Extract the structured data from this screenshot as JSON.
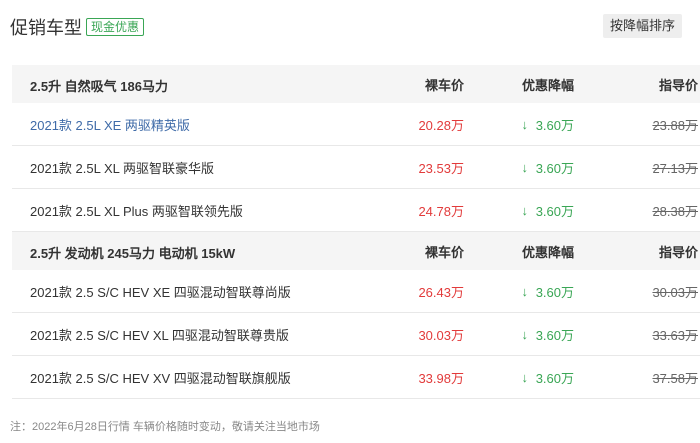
{
  "header": {
    "title": "促销车型",
    "badge": "现金优惠",
    "sort_button": "按降幅排序"
  },
  "colors": {
    "price": "#e23b3b",
    "discount": "#3aa655",
    "link": "#3f6ba8"
  },
  "groups": [
    {
      "title": "2.5升 自然吸气 186马力",
      "col_price": "裸车价",
      "col_discount": "优惠降幅",
      "col_guide": "指导价",
      "rows": [
        {
          "model": "2021款 2.5L XE 两驱精英版",
          "price": "20.28万",
          "discount": "3.60万",
          "guide": "23.88万"
        },
        {
          "model": "2021款 2.5L XL 两驱智联豪华版",
          "price": "23.53万",
          "discount": "3.60万",
          "guide": "27.13万"
        },
        {
          "model": "2021款 2.5L XL Plus 两驱智联领先版",
          "price": "24.78万",
          "discount": "3.60万",
          "guide": "28.38万"
        }
      ]
    },
    {
      "title": "2.5升 发动机 245马力 电动机 15kW",
      "col_price": "裸车价",
      "col_discount": "优惠降幅",
      "col_guide": "指导价",
      "rows": [
        {
          "model": "2021款 2.5 S/C HEV XE 四驱混动智联尊尚版",
          "price": "26.43万",
          "discount": "3.60万",
          "guide": "30.03万"
        },
        {
          "model": "2021款 2.5 S/C HEV XL 四驱混动智联尊贵版",
          "price": "30.03万",
          "discount": "3.60万",
          "guide": "33.63万"
        },
        {
          "model": "2021款 2.5 S/C HEV XV 四驱混动智联旗舰版",
          "price": "33.98万",
          "discount": "3.60万",
          "guide": "37.58万"
        }
      ]
    }
  ],
  "footnote": "注：2022年6月28日行情 车辆价格随时变动，敬请关注当地市场"
}
